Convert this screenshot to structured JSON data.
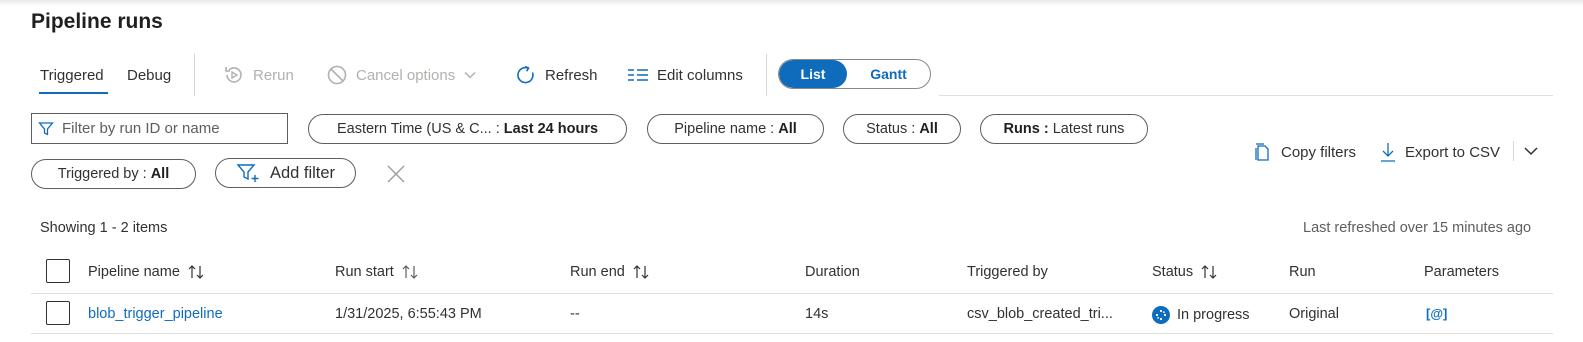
{
  "header": {
    "title": "Pipeline runs"
  },
  "tabs": [
    {
      "label": "Triggered",
      "active": true
    },
    {
      "label": "Debug",
      "active": false
    }
  ],
  "toolbar": {
    "rerun": "Rerun",
    "cancel_options": "Cancel options",
    "refresh": "Refresh",
    "edit_columns": "Edit columns",
    "view_toggle": {
      "list": "List",
      "gantt": "Gantt",
      "selected": "List"
    }
  },
  "filters": {
    "search_placeholder": "Filter by run ID or name",
    "time_zone": {
      "label": "Eastern Time (US & C... :",
      "value": "Last 24 hours"
    },
    "pipeline_name": {
      "label": "Pipeline name :",
      "value": "All"
    },
    "status": {
      "label": "Status :",
      "value": "All"
    },
    "runs": {
      "label": "Runs :",
      "value": "Latest runs"
    },
    "triggered_by": {
      "label": "Triggered by :",
      "value": "All"
    },
    "add_filter": "Add filter"
  },
  "actions": {
    "copy_filters": "Copy filters",
    "export_csv": "Export to CSV"
  },
  "summary": {
    "showing": "Showing 1 - 2 items",
    "last_refreshed": "Last refreshed over 15 minutes ago"
  },
  "table": {
    "columns": [
      "Pipeline name",
      "Run start",
      "Run end",
      "Duration",
      "Triggered by",
      "Status",
      "Run",
      "Parameters"
    ],
    "rows": [
      {
        "pipeline_name": "blob_trigger_pipeline",
        "run_start": "1/31/2025, 6:55:43 PM",
        "run_end": "--",
        "duration": "14s",
        "triggered_by": "csv_blob_created_tri...",
        "status": "In progress",
        "run": "Original",
        "parameters": "[@]"
      }
    ]
  },
  "colors": {
    "accent": "#0f6cbd",
    "text": "#323130",
    "disabled": "#b3b0ad",
    "border": "#605e5c"
  }
}
